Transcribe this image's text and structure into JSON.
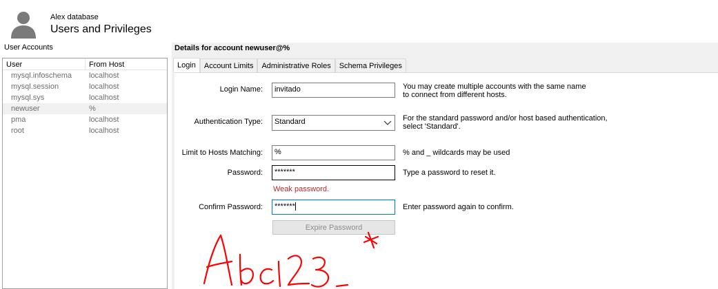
{
  "header": {
    "db_name": "Alex database",
    "title": "Users and Privileges",
    "avatar_icon": "user-silhouette-icon"
  },
  "accounts": {
    "title": "User Accounts",
    "columns": [
      "User",
      "From Host"
    ],
    "rows": [
      {
        "user": "mysql.infoschema",
        "host": "localhost"
      },
      {
        "user": "mysql.session",
        "host": "localhost"
      },
      {
        "user": "mysql.sys",
        "host": "localhost"
      },
      {
        "user": "newuser",
        "host": "%"
      },
      {
        "user": "pma",
        "host": "localhost"
      },
      {
        "user": "root",
        "host": "localhost"
      }
    ],
    "selected_index": 3
  },
  "details": {
    "title": "Details for account newuser@%",
    "tabs": [
      "Login",
      "Account Limits",
      "Administrative Roles",
      "Schema Privileges"
    ],
    "active_tab": "Login"
  },
  "login": {
    "login_name_label": "Login Name:",
    "login_name_value": "invitado",
    "login_name_help_1": "You may create multiple accounts with the same name",
    "login_name_help_2": "to connect from different hosts.",
    "auth_type_label": "Authentication Type:",
    "auth_type_value": "Standard",
    "auth_type_help_1": "For the standard password and/or host based authentication,",
    "auth_type_help_2": "select 'Standard'.",
    "hosts_label": "Limit to Hosts Matching:",
    "hosts_value": "%",
    "hosts_help": "% and _ wildcards may be used",
    "password_label": "Password:",
    "password_value": "*******",
    "password_help": "Type a password to reset it.",
    "password_warning": "Weak password.",
    "confirm_label": "Confirm Password:",
    "confirm_value": "*******",
    "confirm_help": "Enter password again to confirm.",
    "expire_button": "Expire Password"
  },
  "annotation": {
    "handwritten_text": "Abc123_*",
    "color": "#ff0000"
  },
  "colors": {
    "accent": "#0078d7",
    "warning": "#b52a2a"
  }
}
